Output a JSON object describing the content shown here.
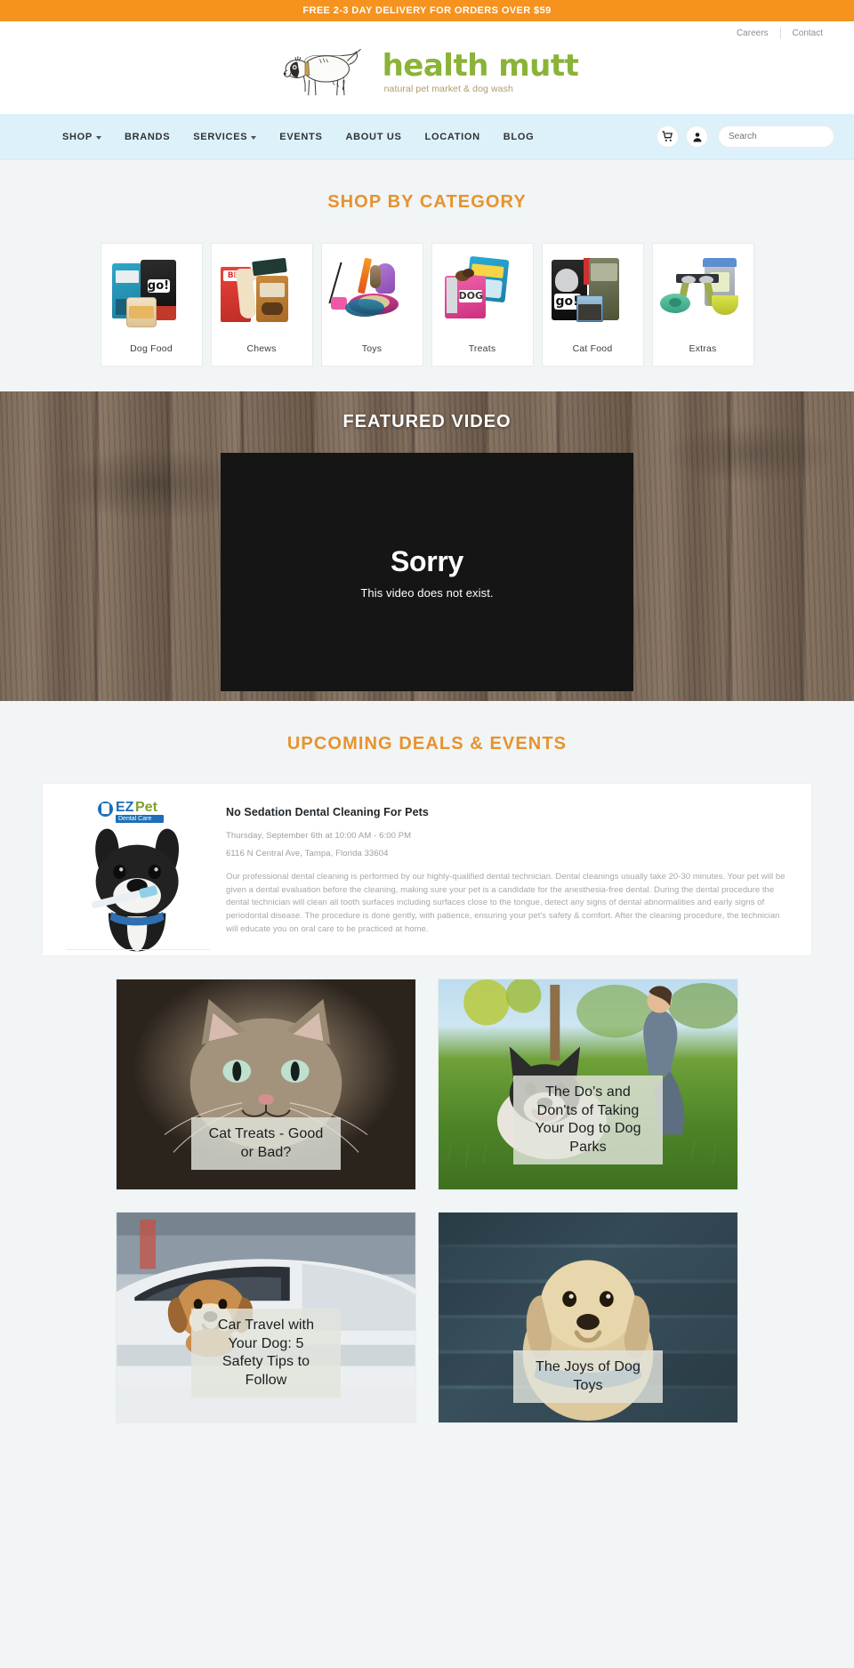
{
  "announcement": {
    "text": "FREE 2-3 DAY DELIVERY FOR ORDERS OVER $59"
  },
  "utility": {
    "careers": "Careers",
    "contact": "Contact"
  },
  "brand": {
    "name": "health mutt",
    "tagline": "natural pet market & dog wash",
    "logo_icon": "dog-illustration-icon",
    "name_color": "#8ab337",
    "accent_color": "#f6921e"
  },
  "nav": {
    "items": [
      {
        "label": "SHOP",
        "has_caret": true
      },
      {
        "label": "BRANDS",
        "has_caret": false
      },
      {
        "label": "SERVICES",
        "has_caret": true
      },
      {
        "label": "EVENTS",
        "has_caret": false
      },
      {
        "label": "ABOUT US",
        "has_caret": false
      },
      {
        "label": "LOCATION",
        "has_caret": false
      },
      {
        "label": "BLOG",
        "has_caret": false
      }
    ],
    "cart_icon": "shopping-cart-icon",
    "account_icon": "user-account-icon",
    "search": {
      "placeholder": "Search",
      "value": "",
      "icon": "search-icon"
    }
  },
  "categories": {
    "heading": "SHOP BY CATEGORY",
    "items": [
      {
        "label": "Dog Food"
      },
      {
        "label": "Chews"
      },
      {
        "label": "Toys"
      },
      {
        "label": "Treats"
      },
      {
        "label": "Cat Food"
      },
      {
        "label": "Extras"
      }
    ]
  },
  "video": {
    "heading": "FEATURED VIDEO",
    "error_title": "Sorry",
    "error_message": "This video does not exist."
  },
  "events": {
    "heading": "UPCOMING DEALS & EVENTS",
    "item": {
      "title": "No Sedation Dental Cleaning For Pets",
      "datetime": "Thursday, September 6th at 10:00 AM - 6:00 PM",
      "address": "6116 N Central Ave, Tampa, Florida 33604",
      "description": "Our professional dental cleaning is performed by our highly-qualified dental technician. Dental cleanings usually take 20-30 minutes. Your pet will be given a dental evaluation before the cleaning, making sure your pet is a candidate for the anesthesia-free dental. During the dental procedure the dental technician will clean all tooth surfaces including surfaces close to the tongue, detect any signs of dental abnormalities and early signs of periodontal disease. The procedure is done gently, with patience, ensuring your pet's safety & comfort. After the cleaning procedure, the technician will educate you on oral care to be practiced at home.",
      "logo_text": "EZPet",
      "logo_sub": "Dental Care"
    }
  },
  "blog": {
    "posts": [
      {
        "title": "Cat Treats - Good or Bad?"
      },
      {
        "title": "The Do's and Don'ts of Taking Your Dog to Dog Parks"
      },
      {
        "title": "Car Travel with Your Dog: 5 Safety Tips to Follow"
      },
      {
        "title": "The Joys of Dog Toys"
      }
    ]
  }
}
